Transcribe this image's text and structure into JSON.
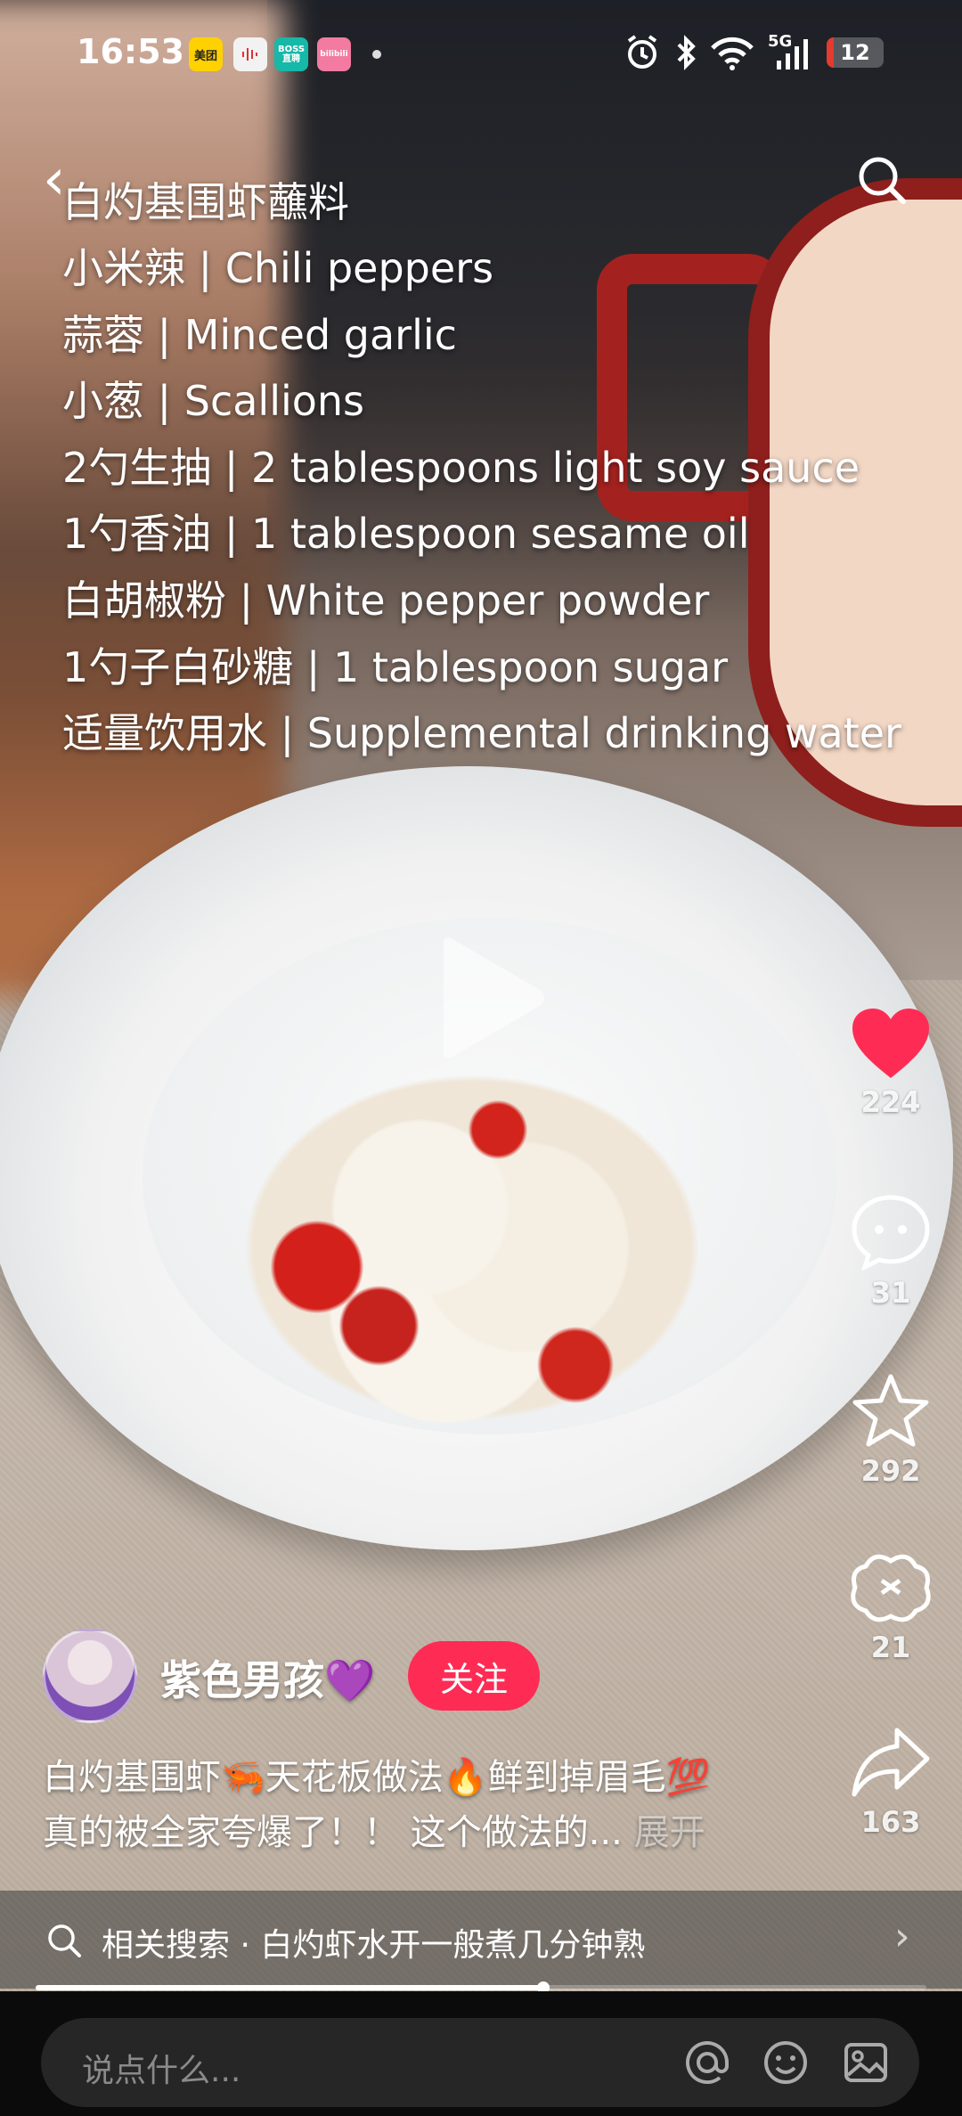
{
  "status_bar": {
    "time": "16:53",
    "badges": [
      "美团",
      "BOSS直聘",
      "bilibili"
    ],
    "network": "5G",
    "battery": "12",
    "battery_level": 0.12
  },
  "overlay": {
    "title": "白灼基围虾蘸料",
    "lines": [
      "小米辣 | Chili peppers",
      "蒜蓉 | Minced garlic",
      "小葱 | Scallions",
      "2勺生抽 | 2 tablespoons light soy sauce",
      "1勺香油 | 1 tablespoon sesame oil",
      "白胡椒粉 | White pepper powder",
      "1勺子白砂糖 | 1 tablespoon sugar",
      "适量饮用水 | Supplemental drinking water"
    ]
  },
  "actions": {
    "likes": "224",
    "comments": "31",
    "favorites": "292",
    "gifts": "21",
    "shares": "163"
  },
  "author": {
    "name": "紫色男孩💜",
    "follow_label": "关注"
  },
  "description": {
    "line1": "白灼基围虾🦐天花板做法🔥鲜到掉眉毛💯",
    "line2": "真的被全家夸爆了！！ 这个做法的...",
    "more": "展开"
  },
  "related_search": {
    "text": "相关搜索 · 白灼虾水开一般煮几分钟熟"
  },
  "progress": 0.57,
  "comment_bar": {
    "placeholder": "说点什么..."
  },
  "colors": {
    "like": "#fe2c55",
    "follow": "#fe2c55"
  }
}
